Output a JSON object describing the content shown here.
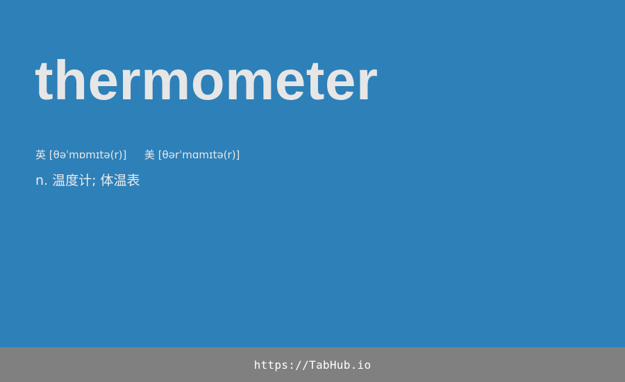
{
  "entry": {
    "word": "thermometer",
    "uk_label": "英",
    "uk_phonetic": "[θəˈmɒmɪtə(r)]",
    "us_label": "美",
    "us_phonetic": "[θərˈmɑmɪtə(r)]",
    "definition": "n. 温度计; 体温表"
  },
  "footer": {
    "link_text": "https://TabHub.io"
  },
  "colors": {
    "background": "#2e80b8",
    "footer_background": "#808080",
    "text": "#e6e6e6"
  }
}
